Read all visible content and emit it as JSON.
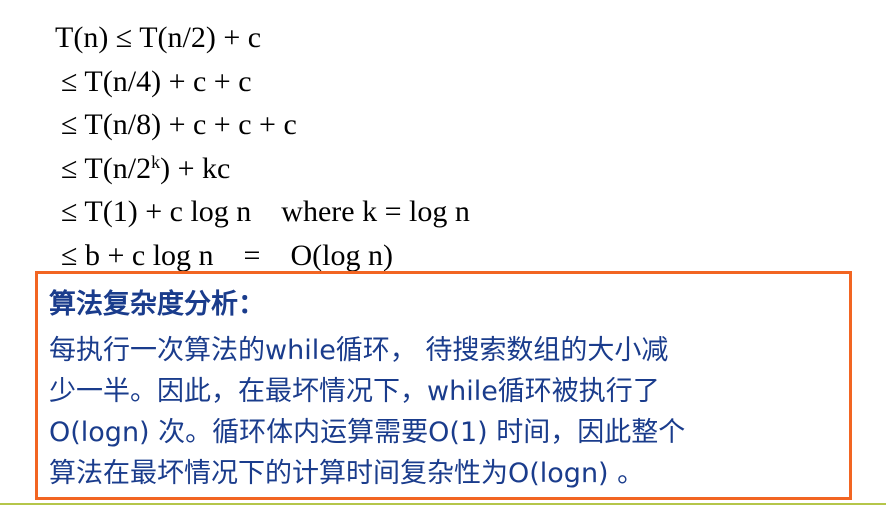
{
  "derivation": {
    "line1": "T(n) ≤ T(n/2) + c",
    "line2": "≤ T(n/4) + c + c",
    "line3": "≤ T(n/8) + c + c + c",
    "line4_pre": "≤ T(n/2",
    "line4_sup": "k",
    "line4_post": ") + kc",
    "line5": "≤ T(1) + c log n    where k = log n",
    "line6": "≤ b + c log n    =    O(log n)"
  },
  "analysis": {
    "title": "算法复杂度分析：",
    "lines": [
      "每执行一次算法的while循环， 待搜索数组的大小减",
      "少一半。因此，在最坏情况下，while循环被执行了",
      "O(logn) 次。循环体内运算需要O(1) 时间，因此整个",
      "算法在最坏情况下的计算时间复杂性为O(logn) 。"
    ]
  },
  "colors": {
    "box_border": "#f26522",
    "text_blue": "#1a3c8c",
    "rule": "#b5c64a"
  }
}
